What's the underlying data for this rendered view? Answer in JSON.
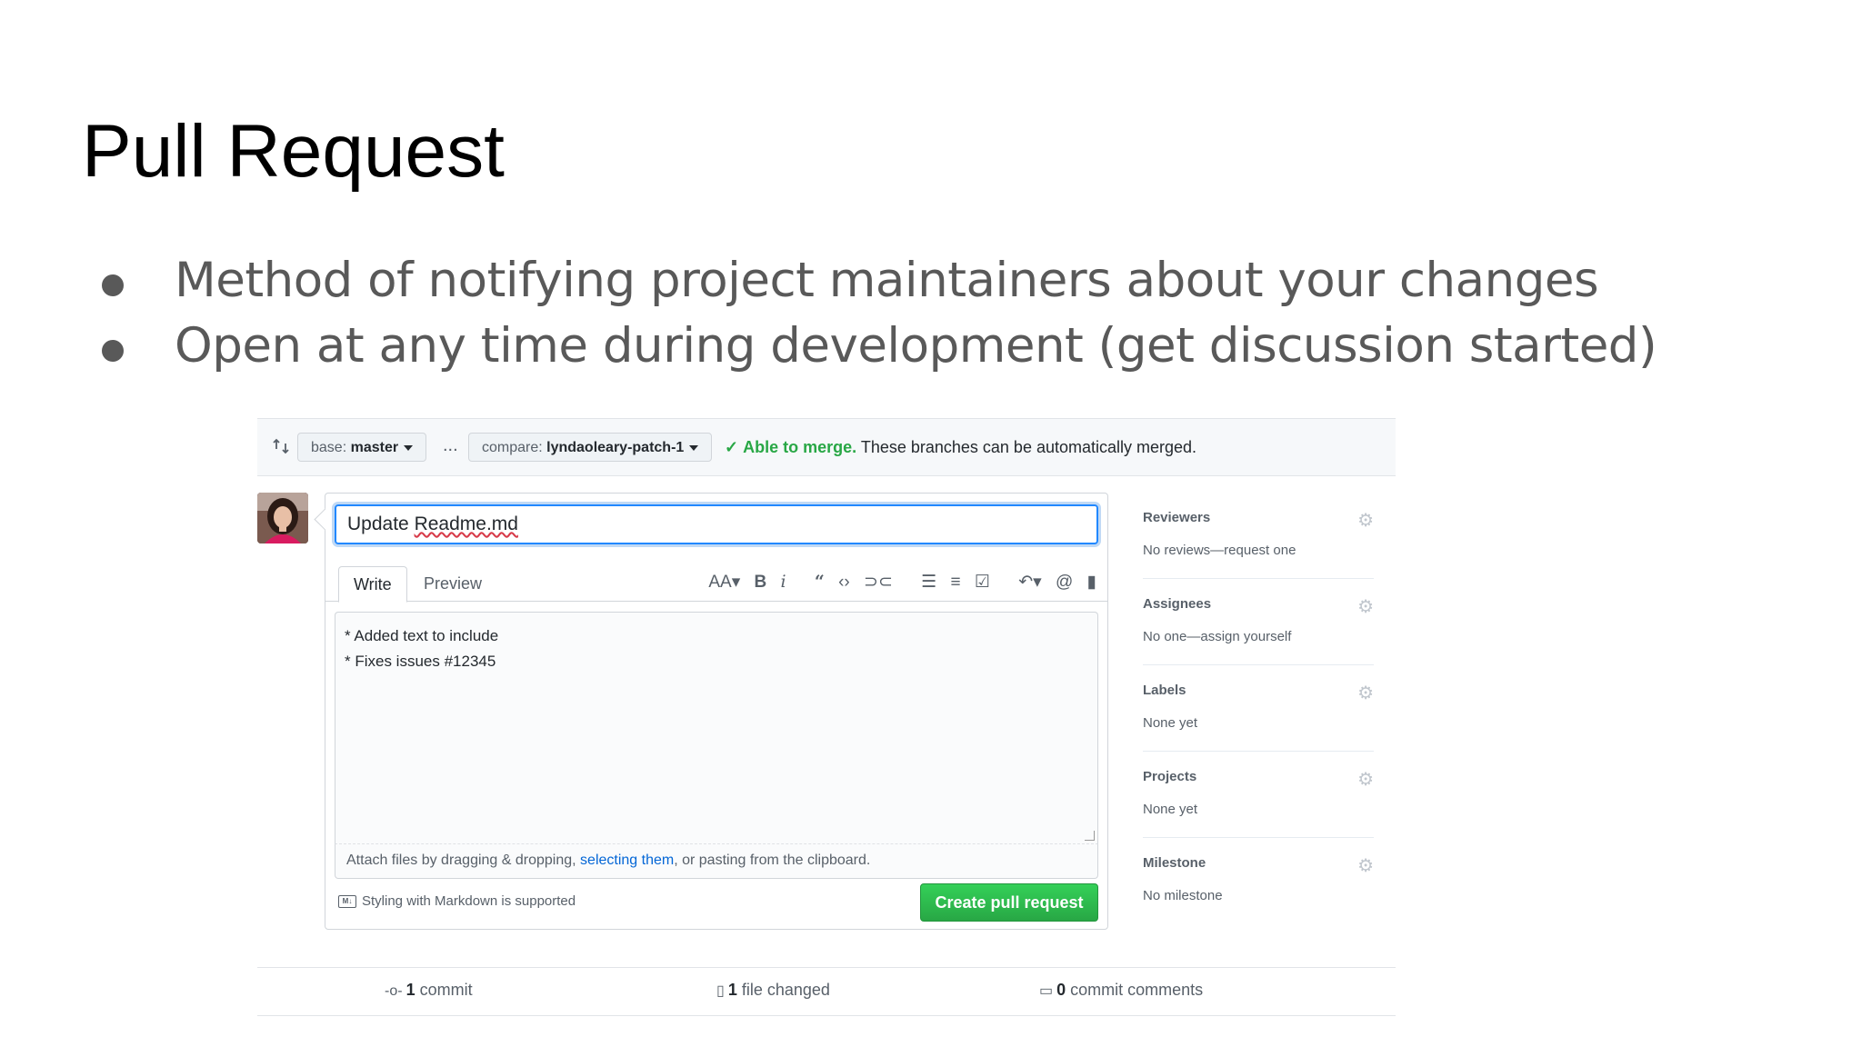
{
  "slide": {
    "title": "Pull Request",
    "bullets": [
      "Method of notifying project maintainers about your changes",
      "Open at any time during development (get discussion started)"
    ]
  },
  "compare_bar": {
    "base_prefix": "base: ",
    "base_branch": "master",
    "separator": "...",
    "compare_prefix": "compare: ",
    "compare_branch": "lyndaoleary-patch-1",
    "merge_ok": "Able to merge.",
    "merge_text": "These branches can be automatically merged."
  },
  "form": {
    "title_value": "Update Readme.md",
    "title_word1": "Update ",
    "title_word2": "Readme.md",
    "tabs": [
      "Write",
      "Preview"
    ],
    "toolbar_icons": [
      "text-size-icon",
      "bold-icon",
      "italic-icon",
      "quote-icon",
      "code-icon",
      "link-icon",
      "bullet-list-icon",
      "numbered-list-icon",
      "task-list-icon",
      "reply-icon",
      "mention-icon",
      "bookmark-icon"
    ],
    "body_lines": [
      "* Added text to include",
      "* Fixes issues #12345"
    ],
    "attach_before": "Attach files by dragging & dropping, ",
    "attach_link": "selecting them",
    "attach_after": ", or pasting from the clipboard.",
    "markdown_note": "Styling with Markdown is supported",
    "submit_label": "Create pull request"
  },
  "sidebar": {
    "sections": [
      {
        "heading": "Reviewers",
        "value": "No reviews—request one"
      },
      {
        "heading": "Assignees",
        "value": "No one—assign yourself"
      },
      {
        "heading": "Labels",
        "value": "None yet"
      },
      {
        "heading": "Projects",
        "value": "None yet"
      },
      {
        "heading": "Milestone",
        "value": "No milestone"
      }
    ]
  },
  "stats": {
    "commits_count": "1",
    "commits_label": " commit",
    "files_count": "1",
    "files_label": " file changed",
    "comments_count": "0",
    "comments_label": " commit comments"
  },
  "colors": {
    "accent_blue": "#0366d6",
    "success_green": "#28a745",
    "text_gray": "#586069"
  }
}
